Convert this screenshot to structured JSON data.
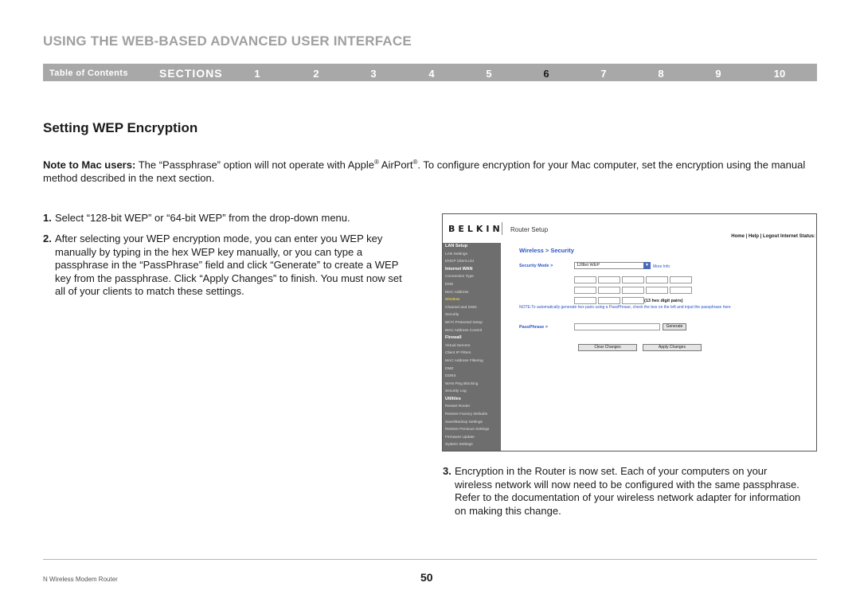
{
  "header": {
    "title": "USING THE WEB-BASED ADVANCED USER INTERFACE"
  },
  "nav": {
    "toc_label": "Table of Contents",
    "sections_label": "SECTIONS",
    "numbers": [
      "1",
      "2",
      "3",
      "4",
      "5",
      "6",
      "7",
      "8",
      "9",
      "10"
    ],
    "active": "6"
  },
  "section_title": "Setting WEP Encryption",
  "note": {
    "bold": "Note to Mac users:",
    "text_1": " The “Passphrase” option will not operate with Apple",
    "reg_1": "®",
    "text_2": " AirPort",
    "reg_2": "®",
    "text_3": ". To configure encryption for your Mac computer, set the encryption using the manual method described in the next section."
  },
  "steps": [
    {
      "num": "1.",
      "text": "Select “128-bit WEP” or “64-bit WEP” from the drop-down menu."
    },
    {
      "num": "2.",
      "text": "After selecting your WEP encryption mode, you can enter you WEP key manually by typing in the hex WEP key manually, or you can type a passphrase in the “PassPhrase” field and click “Generate” to create a WEP key from the passphrase. Click “Apply Changes” to finish. You must now set all of your clients to match these settings."
    },
    {
      "num": "3.",
      "text": "Encryption in the Router is now set. Each of your computers on your wireless network will now need to be configured with the same passphrase. Refer to the documentation of your wireless network adapter for information on making this change."
    }
  ],
  "router": {
    "logo": "BELKIN",
    "setup_label": "Router Setup",
    "links": "Home | Help | Logout   Internet Status:",
    "sidebar": [
      {
        "label": "LAN Setup",
        "kind": "head"
      },
      {
        "label": "LAN Settings",
        "kind": "sub"
      },
      {
        "label": "DHCP Client List",
        "kind": "sub"
      },
      {
        "label": "Internet WAN",
        "kind": "head"
      },
      {
        "label": "Connection Type",
        "kind": "sub"
      },
      {
        "label": "DNS",
        "kind": "sub"
      },
      {
        "label": "MAC Address",
        "kind": "sub"
      },
      {
        "label": "Wireless",
        "kind": "sel"
      },
      {
        "label": "Channel and SSID",
        "kind": "sub"
      },
      {
        "label": "Security",
        "kind": "sub"
      },
      {
        "label": "Wi-Fi Protected Setup",
        "kind": "sub"
      },
      {
        "label": "MAC Address Control",
        "kind": "sub"
      },
      {
        "label": "Firewall",
        "kind": "head"
      },
      {
        "label": "Virtual Servers",
        "kind": "sub"
      },
      {
        "label": "Client IP Filters",
        "kind": "sub"
      },
      {
        "label": "MAC Address Filtering",
        "kind": "sub"
      },
      {
        "label": "DMZ",
        "kind": "sub"
      },
      {
        "label": "DDNS",
        "kind": "sub"
      },
      {
        "label": "WAN Ping Blocking",
        "kind": "sub"
      },
      {
        "label": "Security Log",
        "kind": "sub"
      },
      {
        "label": "Utilities",
        "kind": "head"
      },
      {
        "label": "Restart Router",
        "kind": "sub"
      },
      {
        "label": "Restore Factory Defaults",
        "kind": "sub"
      },
      {
        "label": "Save/Backup Settings",
        "kind": "sub"
      },
      {
        "label": "Restore Previous Settings",
        "kind": "sub"
      },
      {
        "label": "Firmware Update",
        "kind": "sub"
      },
      {
        "label": "System Settings",
        "kind": "sub"
      }
    ],
    "page_title": "Wireless > Security",
    "security_mode_label": "Security Mode >",
    "security_mode_value": "128bit WEP",
    "more_info": "More Info",
    "hex_note": "(13 hex digit pairs)",
    "note": "NOTE:To automatically generate hex pairs using a PassPhrase, check the box on the left and input the passphrase here",
    "passphrase_label": "PassPhrase >",
    "generate_button": "Generate",
    "clear_button": "Clear Changes",
    "apply_button": "Apply Changes"
  },
  "footer": {
    "product": "N Wireless Modem Router",
    "page": "50"
  }
}
